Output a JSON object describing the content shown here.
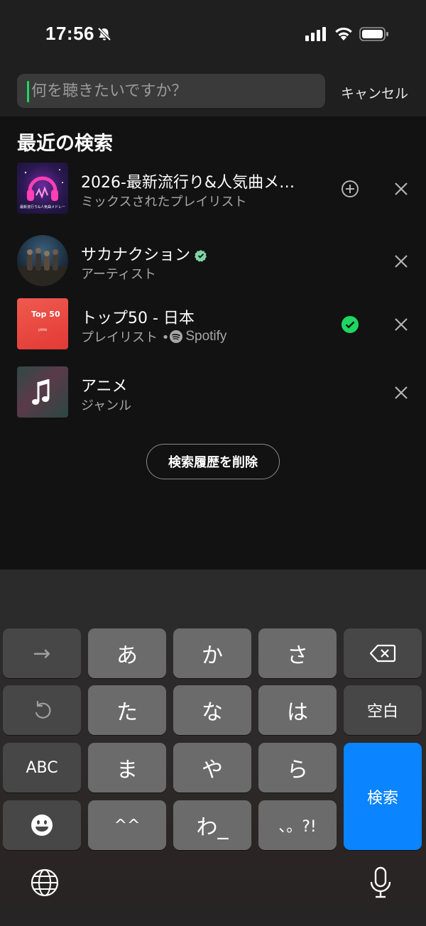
{
  "status_bar": {
    "time": "17:56"
  },
  "search": {
    "placeholder": "何を聴きたいですか？",
    "cancel_label": "キャンセル"
  },
  "recent": {
    "title": "最近の検索",
    "items": [
      {
        "title": "2026-最新流行り&人気曲メ…",
        "subtitle": "ミックスされたプレイリスト",
        "thumb_text": "最新流行り&人気曲メドレー",
        "action": "add-icon"
      },
      {
        "title": "サカナクション",
        "subtitle": "アーティスト",
        "verified": true
      },
      {
        "title": "トップ50 - 日本",
        "subtitle": "プレイリスト • ",
        "subtitle_brand": "Spotify",
        "thumb_text": "Top 50",
        "thumb_subtext": "JAPAN",
        "action": "saved-check-icon"
      },
      {
        "title": "アニメ",
        "subtitle": "ジャンル"
      }
    ],
    "clear_label": "検索履歴を削除"
  },
  "keyboard": {
    "row1": [
      "→",
      "あ",
      "か",
      "さ"
    ],
    "row2": [
      "た",
      "な",
      "は",
      "空白"
    ],
    "row3": [
      "ABC",
      "ま",
      "や",
      "ら"
    ],
    "row4": [
      "^^",
      "わ_",
      "、。?!"
    ],
    "search_key": "検索"
  },
  "colors": {
    "accent": "#1ed760",
    "blue_key": "#0a84ff",
    "top50": "#e8433f"
  }
}
